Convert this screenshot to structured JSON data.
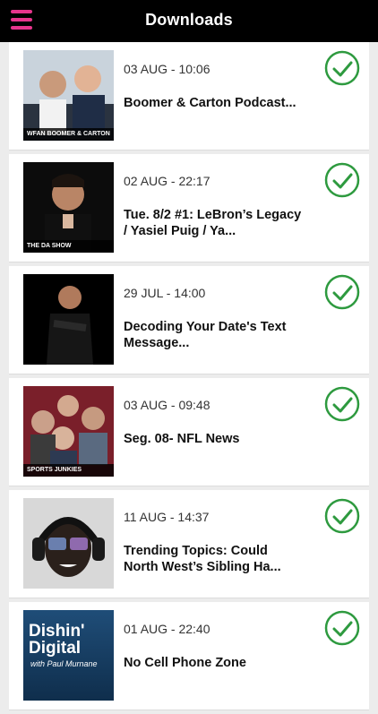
{
  "header": {
    "title": "Downloads",
    "menu_icon": "hamburger-menu-icon",
    "accent": "#e6358c"
  },
  "status_color": "#2e9a3f",
  "items": [
    {
      "date": "03 AUG - 10:06",
      "title": "Boomer & Carton Podcast...",
      "artwork": "Boomer & Carton show artwork",
      "artwork_caption": "WFAN   BOOMER & CARTON",
      "status_icon": "downloaded-check-icon"
    },
    {
      "date": "02 AUG - 22:17",
      "title": "Tue. 8/2 #1: LeBron’s Legacy / Yasiel Puig / Ya...",
      "artwork": "The DA Show artwork",
      "artwork_caption": "THE DA SHOW",
      "status_icon": "downloaded-check-icon"
    },
    {
      "date": "29 JUL - 14:00",
      "title": "Decoding Your Date's Text Message...",
      "artwork": "Host portrait artwork",
      "artwork_caption": "",
      "status_icon": "downloaded-check-icon"
    },
    {
      "date": "03 AUG - 09:48",
      "title": "Seg. 08- NFL News",
      "artwork": "Sports Junkies artwork",
      "artwork_caption": "SPORTS JUNKIES",
      "status_icon": "downloaded-check-icon"
    },
    {
      "date": "11 AUG - 14:37",
      "title": "Trending Topics: Could North West’s Sibling Ha...",
      "artwork": "Man with headphones artwork",
      "artwork_caption": "",
      "status_icon": "downloaded-check-icon"
    },
    {
      "date": "01 AUG - 22:40",
      "title": "No Cell Phone Zone",
      "artwork": "Dishin' Digital artwork",
      "artwork_title": "Dishin' Digital",
      "artwork_sub": "with Paul Murnane",
      "status_icon": "downloaded-check-icon"
    }
  ]
}
